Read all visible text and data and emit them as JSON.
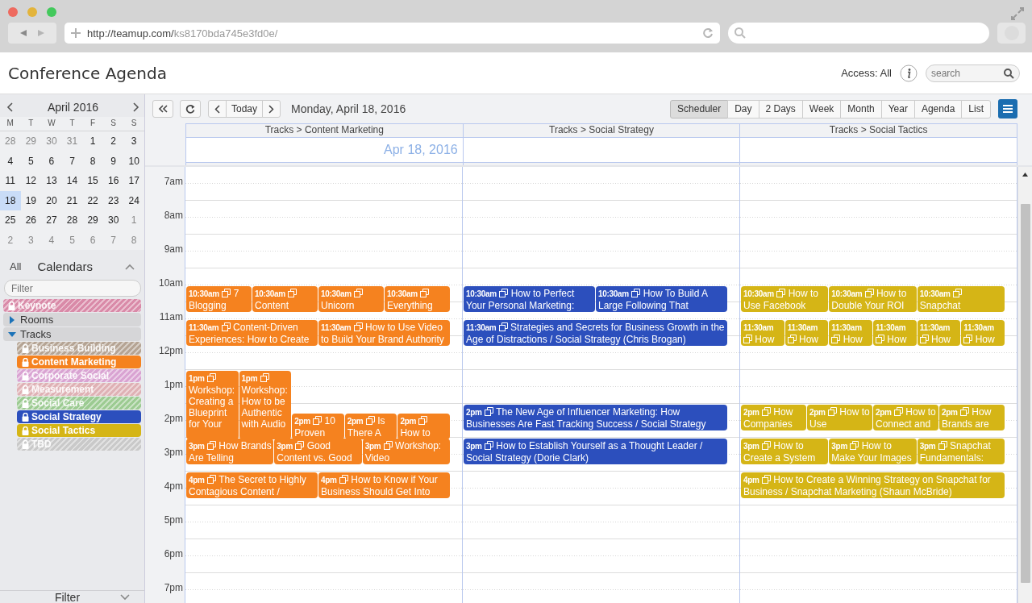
{
  "browser": {
    "url_host": "http://teamup.com/",
    "url_path": "ks8170bda745e3fd0e/"
  },
  "header": {
    "title": "Conference Agenda",
    "access": "Access: All",
    "search": {
      "placeholder": "search"
    }
  },
  "mini_calendar": {
    "month": "April 2016",
    "weekdays": [
      "M",
      "T",
      "W",
      "T",
      "F",
      "S",
      "S"
    ],
    "weeks": [
      [
        {
          "day": "28",
          "outside": true,
          "selected": false
        },
        {
          "day": "29",
          "outside": true,
          "selected": false
        },
        {
          "day": "30",
          "outside": true,
          "selected": false
        },
        {
          "day": "31",
          "outside": true,
          "selected": false
        },
        {
          "day": "1",
          "outside": false,
          "selected": false
        },
        {
          "day": "2",
          "outside": false,
          "selected": false
        },
        {
          "day": "3",
          "outside": false,
          "selected": false
        }
      ],
      [
        {
          "day": "4",
          "outside": false,
          "selected": false
        },
        {
          "day": "5",
          "outside": false,
          "selected": false
        },
        {
          "day": "6",
          "outside": false,
          "selected": false
        },
        {
          "day": "7",
          "outside": false,
          "selected": false
        },
        {
          "day": "8",
          "outside": false,
          "selected": false
        },
        {
          "day": "9",
          "outside": false,
          "selected": false
        },
        {
          "day": "10",
          "outside": false,
          "selected": false
        }
      ],
      [
        {
          "day": "11",
          "outside": false,
          "selected": false
        },
        {
          "day": "12",
          "outside": false,
          "selected": false
        },
        {
          "day": "13",
          "outside": false,
          "selected": false
        },
        {
          "day": "14",
          "outside": false,
          "selected": false
        },
        {
          "day": "15",
          "outside": false,
          "selected": false
        },
        {
          "day": "16",
          "outside": false,
          "selected": false
        },
        {
          "day": "17",
          "outside": false,
          "selected": false
        }
      ],
      [
        {
          "day": "18",
          "outside": false,
          "selected": true
        },
        {
          "day": "19",
          "outside": false,
          "selected": false
        },
        {
          "day": "20",
          "outside": false,
          "selected": false
        },
        {
          "day": "21",
          "outside": false,
          "selected": false
        },
        {
          "day": "22",
          "outside": false,
          "selected": false
        },
        {
          "day": "23",
          "outside": false,
          "selected": false
        },
        {
          "day": "24",
          "outside": false,
          "selected": false
        }
      ],
      [
        {
          "day": "25",
          "outside": false,
          "selected": false
        },
        {
          "day": "26",
          "outside": false,
          "selected": false
        },
        {
          "day": "27",
          "outside": false,
          "selected": false
        },
        {
          "day": "28",
          "outside": false,
          "selected": false
        },
        {
          "day": "29",
          "outside": false,
          "selected": false
        },
        {
          "day": "30",
          "outside": false,
          "selected": false
        },
        {
          "day": "1",
          "outside": true,
          "selected": false
        }
      ],
      [
        {
          "day": "2",
          "outside": true,
          "selected": false
        },
        {
          "day": "3",
          "outside": true,
          "selected": false
        },
        {
          "day": "4",
          "outside": true,
          "selected": false
        },
        {
          "day": "5",
          "outside": true,
          "selected": false
        },
        {
          "day": "6",
          "outside": true,
          "selected": false
        },
        {
          "day": "7",
          "outside": true,
          "selected": false
        },
        {
          "day": "8",
          "outside": true,
          "selected": false
        }
      ]
    ]
  },
  "calendars": {
    "all": "All",
    "title": "Calendars",
    "expanded": true,
    "filter": {
      "placeholder": "Filter"
    },
    "items": [
      {
        "kind": "calendar",
        "label": "Keynote",
        "color": "#d98aa8",
        "shown": false
      },
      {
        "kind": "folder",
        "label": "Rooms",
        "expanded": false
      },
      {
        "kind": "folder",
        "label": "Tracks",
        "expanded": true,
        "children": [
          {
            "kind": "calendar",
            "label": "Business Building",
            "color": "#b5a494",
            "shown": false
          },
          {
            "kind": "calendar",
            "label": "Content Marketing",
            "color": "#f5821f",
            "shown": true
          },
          {
            "kind": "calendar",
            "label": "Corporate Social",
            "color": "#d9a3d2",
            "shown": false
          },
          {
            "kind": "calendar",
            "label": "Measurement",
            "color": "#dfb1b5",
            "shown": false
          },
          {
            "kind": "calendar",
            "label": "Social Care",
            "color": "#9ccb92",
            "shown": false
          },
          {
            "kind": "calendar",
            "label": "Social Strategy",
            "color": "#2c4fbd",
            "shown": true
          },
          {
            "kind": "calendar",
            "label": "Social Tactics",
            "color": "#d5b516",
            "shown": true
          },
          {
            "kind": "calendar",
            "label": "TBD",
            "color": "#c9c9c9",
            "shown": false
          }
        ]
      }
    ]
  },
  "filter_panel": {
    "label": "Filter",
    "expanded": false
  },
  "toolbar": {
    "today": "Today",
    "date": "Monday, April 18, 2016",
    "views": [
      {
        "label": "Scheduler",
        "selected": true
      },
      {
        "label": "Day",
        "selected": false
      },
      {
        "label": "2 Days",
        "selected": false
      },
      {
        "label": "Week",
        "selected": false
      },
      {
        "label": "Month",
        "selected": false
      },
      {
        "label": "Year",
        "selected": false
      },
      {
        "label": "Agenda",
        "selected": false
      },
      {
        "label": "List",
        "selected": false
      }
    ]
  },
  "scheduler": {
    "hours": [
      "7am",
      "8am",
      "9am",
      "10am",
      "11am",
      "12pm",
      "1pm",
      "2pm",
      "3pm",
      "4pm",
      "5pm",
      "6pm",
      "7pm"
    ],
    "columns": [
      {
        "title": "Tracks > Content Marketing",
        "date": "Apr 18, 2016",
        "color": "#f5821f",
        "blocks": [
          {
            "events": [
              {
                "time": "10:30am",
                "title": "7 Blogging",
                "kind": "one-hour"
              },
              {
                "time": "10:30am",
                "title": "Content",
                "kind": "one-hour"
              },
              {
                "time": "10:30am",
                "title": "Unicorn",
                "kind": "one-hour"
              },
              {
                "time": "10:30am",
                "title": "Everything",
                "kind": "one-hour"
              }
            ]
          },
          {
            "events": [
              {
                "time": "11:30am",
                "title": "Content-Driven Experiences: How to Create",
                "kind": "one-hour"
              },
              {
                "time": "11:30am",
                "title": "How to Use Video to Build Your Brand Authority",
                "kind": "one-hour"
              }
            ]
          },
          {
            "events": [
              {
                "time": "1pm",
                "title": "Workshop: Creating a Blueprint for Your",
                "kind": "two-hour"
              },
              {
                "time": "1pm",
                "title": "Workshop: How to be Authentic with Audio",
                "kind": "two-hour"
              },
              {
                "time": "2pm",
                "title": "10 Proven",
                "kind": "one-hour"
              },
              {
                "time": "2pm",
                "title": "Is There A",
                "kind": "one-hour"
              },
              {
                "time": "2pm",
                "title": "How to",
                "kind": "one-hour"
              }
            ]
          },
          {
            "events": [
              {
                "time": "3pm",
                "title": "How Brands Are Telling",
                "kind": "one-hour"
              },
              {
                "time": "3pm",
                "title": "Good Content vs. Good",
                "kind": "one-hour"
              },
              {
                "time": "3pm",
                "title": "Workshop: Video",
                "kind": "one-hour"
              }
            ]
          },
          {
            "events": [
              {
                "time": "4pm",
                "title": "The Secret to Highly Contagious Content /",
                "kind": "one-hour"
              },
              {
                "time": "4pm",
                "title": "How to Know if Your Business Should Get Into",
                "kind": "one-hour"
              }
            ]
          }
        ]
      },
      {
        "title": "Tracks > Social Strategy",
        "color": "#2c4fbd",
        "blocks": [
          {
            "events": [
              {
                "time": "10:30am",
                "title": "How to Perfect Your Personal Marketing:",
                "kind": "one-hour"
              },
              {
                "time": "10:30am",
                "title": "How To Build A Large Following That",
                "kind": "one-hour"
              }
            ]
          },
          {
            "events": [
              {
                "time": "11:30am",
                "title": "Strategies and Secrets for Business Growth in the Age of Distractions / Social Strategy (Chris Brogan)",
                "kind": "one-hour"
              }
            ]
          },
          {
            "events": [
              {
                "time": "2pm",
                "title": "The New Age of Influencer Marketing: How Businesses Are Fast Tracking Success / Social Strategy",
                "kind": "one-hour"
              }
            ]
          },
          {
            "events": [
              {
                "time": "3pm",
                "title": "How to Establish Yourself as a Thought Leader / Social Strategy (Dorie Clark)",
                "kind": "one-hour"
              }
            ]
          }
        ]
      },
      {
        "title": "Tracks > Social Tactics",
        "color": "#d5b516",
        "blocks": [
          {
            "events": [
              {
                "time": "10:30am",
                "title": "How to Use Facebook",
                "kind": "one-hour"
              },
              {
                "time": "10:30am",
                "title": "How to Double Your ROI",
                "kind": "one-hour"
              },
              {
                "time": "10:30am",
                "title": "Snapchat",
                "kind": "one-hour"
              }
            ]
          },
          {
            "events": [
              {
                "time": "11:30am",
                "title": "How",
                "kind": "one-hour"
              },
              {
                "time": "11:30am",
                "title": "How",
                "kind": "one-hour"
              },
              {
                "time": "11:30am",
                "title": "How",
                "kind": "one-hour"
              },
              {
                "time": "11:30am",
                "title": "How",
                "kind": "one-hour"
              },
              {
                "time": "11:30am",
                "title": "How",
                "kind": "one-hour"
              },
              {
                "time": "11:30am",
                "title": "How",
                "kind": "one-hour"
              }
            ]
          },
          {
            "events": [
              {
                "time": "2pm",
                "title": "How Companies",
                "kind": "one-hour"
              },
              {
                "time": "2pm",
                "title": "How to Use",
                "kind": "one-hour"
              },
              {
                "time": "2pm",
                "title": "How to Connect and",
                "kind": "one-hour"
              },
              {
                "time": "2pm",
                "title": "How Brands are",
                "kind": "one-hour"
              }
            ]
          },
          {
            "events": [
              {
                "time": "3pm",
                "title": "How to Create a System",
                "kind": "one-hour"
              },
              {
                "time": "3pm",
                "title": "How to Make Your Images",
                "kind": "one-hour"
              },
              {
                "time": "3pm",
                "title": "Snapchat Fundamentals:",
                "kind": "one-hour"
              }
            ]
          },
          {
            "events": [
              {
                "time": "4pm",
                "title": "How to Create a Winning Strategy on Snapchat for Business / Snapchat Marketing (Shaun McBride)",
                "kind": "one-hour"
              }
            ]
          }
        ]
      }
    ]
  }
}
